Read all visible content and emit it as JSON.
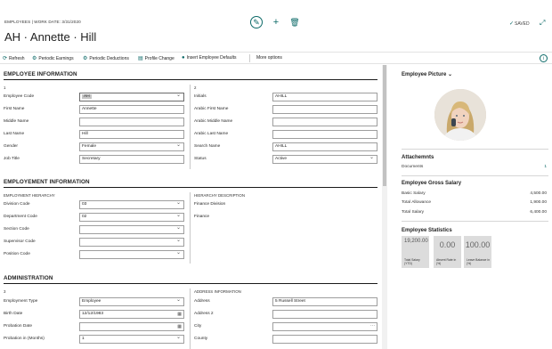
{
  "header": {
    "context": "EMPLOYEES | WORK DATE: 3/31/2020",
    "title": "AH · Annette · Hill",
    "saved": "SAVED"
  },
  "actions": [
    {
      "label": "Refresh",
      "icon": "refresh-icon"
    },
    {
      "label": "Periodic Earnings",
      "icon": "earnings-icon"
    },
    {
      "label": "Periodic Deductions",
      "icon": "deductions-icon"
    },
    {
      "label": "Profile Change",
      "icon": "profile-icon"
    },
    {
      "label": "Insert Employee Defaults",
      "icon": "insert-icon"
    },
    {
      "label": "More options",
      "icon": ""
    }
  ],
  "employee_info": {
    "heading": "EMPLOYEE INFORMATION",
    "group_left": "1",
    "group_right": "2",
    "left_fields": [
      {
        "label": "Employee Code",
        "value": "AH"
      },
      {
        "label": "First Name",
        "value": "Annette"
      },
      {
        "label": "Middle Name",
        "value": ""
      },
      {
        "label": "Last Name",
        "value": "Hill"
      },
      {
        "label": "Gender",
        "value": "Female"
      },
      {
        "label": "Job Title",
        "value": "Secretary"
      }
    ],
    "right_fields": [
      {
        "label": "Initials",
        "value": "AHILL"
      },
      {
        "label": "Arabic First Name",
        "value": ""
      },
      {
        "label": "Arabic Middle Name",
        "value": ""
      },
      {
        "label": "Arabic Last Name",
        "value": ""
      },
      {
        "label": "Search Name",
        "value": "AHILL"
      },
      {
        "label": "Status",
        "value": "Active"
      }
    ]
  },
  "employment_info": {
    "heading": "EMPLOYEMENT INFORMATION",
    "group_left": "EMPLOYMENT HIERARCHY",
    "group_right": "HIERARCHY DESCRIPTION",
    "fields": [
      {
        "label": "Division Code",
        "value": "03"
      },
      {
        "label": "Department Code",
        "value": "02"
      },
      {
        "label": "Section Code",
        "value": ""
      },
      {
        "label": "Supervisor Code",
        "value": ""
      },
      {
        "label": "Position Code",
        "value": ""
      }
    ],
    "descriptions": [
      "Finance Division",
      "Finance"
    ]
  },
  "administration": {
    "heading": "ADMINISTRATION",
    "group_left": "3",
    "group_right": "ADDRESS INFORMATION",
    "left_fields": [
      {
        "label": "Employment Type",
        "value": "Employee"
      },
      {
        "label": "Birth Date",
        "value": "12/12/1983"
      },
      {
        "label": "Probation Date",
        "value": ""
      },
      {
        "label": "Probation in (Months)",
        "value": "1"
      }
    ],
    "right_fields": [
      {
        "label": "Address",
        "value": "5 Russell Street"
      },
      {
        "label": "Address 2",
        "value": ""
      },
      {
        "label": "City",
        "value": ""
      },
      {
        "label": "County",
        "value": ""
      }
    ]
  },
  "factbox": {
    "picture_heading": "Employee Picture",
    "attachments_heading": "Attachemnts",
    "documents_label": "Documents",
    "documents_value": "1",
    "gross_heading": "Employee Gross Salary",
    "gross_rows": [
      {
        "label": "Basic Salary",
        "value": "4,500.00"
      },
      {
        "label": "Total Allowance",
        "value": "1,900.00"
      },
      {
        "label": "Total Salary",
        "value": "6,400.00"
      }
    ],
    "stats_heading": "Employee Statistics",
    "tiles": [
      {
        "value": "19,200.00",
        "label": "Total Salary (YTD)"
      },
      {
        "value": "0.00",
        "label": "Absent Rate in (%)"
      },
      {
        "value": "100.00",
        "label": "Leave Balance in (%)"
      }
    ]
  },
  "colors": {
    "accent": "#0c6a68",
    "text": "#212121",
    "tile": "#dcdcdc"
  }
}
